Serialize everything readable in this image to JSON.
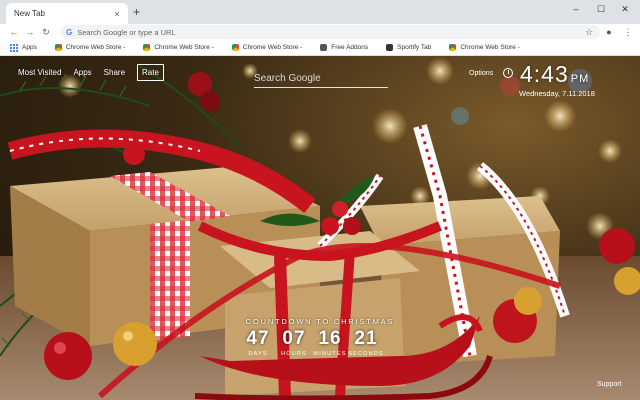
{
  "browser": {
    "tab_title": "New Tab",
    "tab_close": "×",
    "new_tab": "+",
    "window_controls": [
      "–",
      "☐",
      "✕"
    ],
    "omnibox_placeholder": "Search Google or type a URL"
  },
  "bookmarks": [
    {
      "label": "Apps",
      "icon": "apps-grid-icon"
    },
    {
      "label": "Chrome Web Store -",
      "icon": "chrome-icon"
    },
    {
      "label": "Chrome Web Store -",
      "icon": "chrome-icon"
    },
    {
      "label": "Chrome Web Store -",
      "icon": "chrome-icon"
    },
    {
      "label": "Free Addons",
      "icon": "addons-icon"
    },
    {
      "label": "Sportify Tab",
      "icon": "tab-icon"
    },
    {
      "label": "Chrome Web Store -",
      "icon": "chrome-icon"
    }
  ],
  "newtab": {
    "links": {
      "most_visited": "Most Visited",
      "apps": "Apps",
      "share": "Share",
      "rate": "Rate"
    },
    "search_placeholder": "Search Google",
    "options": "Options",
    "time": "4:43",
    "ampm": "PM",
    "date": "Wednesday, 7.11.2018",
    "countdown": {
      "title": "COUNTDOWN TO CHRISTMAS",
      "days": "47",
      "hours": "07",
      "minutes": "16",
      "seconds": "21",
      "labels": {
        "days": "DAYS",
        "hours": "HOURS",
        "minutes": "MINUTES",
        "seconds": "SECONDS"
      }
    },
    "support": "Support"
  },
  "colors": {
    "ribbon_red": "#c8141e",
    "box_kraft": "#c9a772",
    "background_warm": "#3a2a14"
  }
}
